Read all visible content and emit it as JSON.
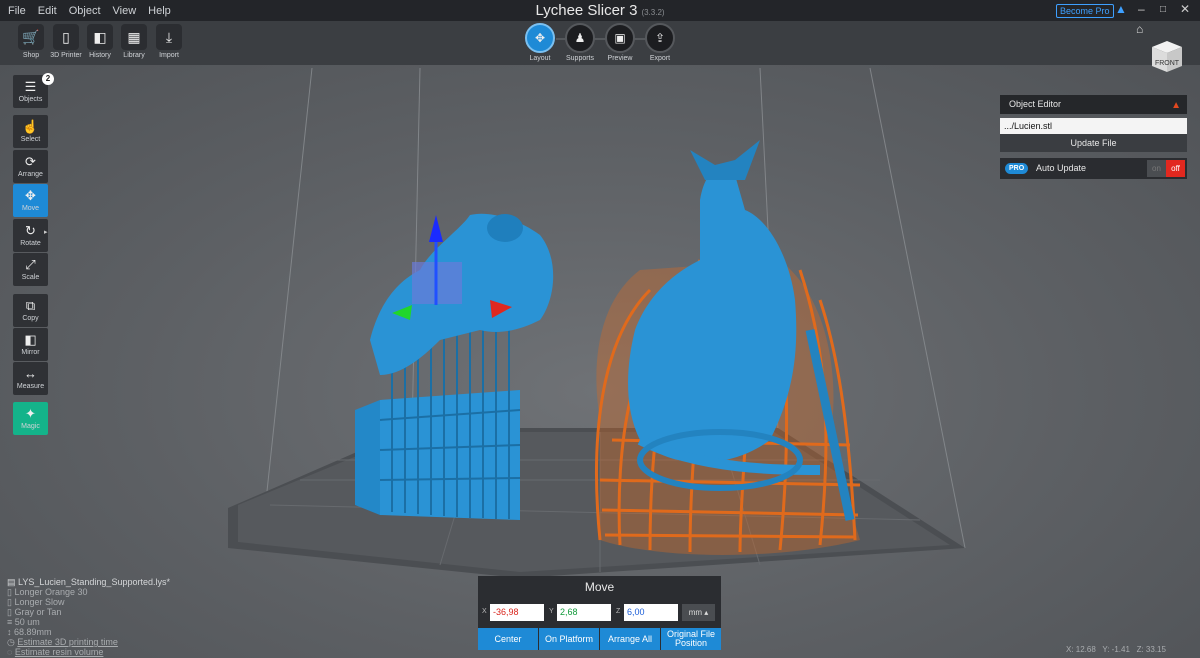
{
  "menu": [
    "File",
    "Edit",
    "Object",
    "View",
    "Help"
  ],
  "app": {
    "title": "Lychee Slicer 3",
    "version": "(3.3.2)",
    "become_pro": "Become Pro"
  },
  "toolbar": {
    "left": [
      {
        "label": "Shop",
        "icon": "cart-icon"
      },
      {
        "label": "3D Printer",
        "icon": "printer-icon"
      },
      {
        "label": "History",
        "icon": "history-icon"
      },
      {
        "label": "Library",
        "icon": "library-icon"
      },
      {
        "label": "Import",
        "icon": "import-icon"
      }
    ],
    "modes": [
      {
        "label": "Layout",
        "icon": "layout-icon",
        "active": true
      },
      {
        "label": "Supports",
        "icon": "supports-icon",
        "active": false
      },
      {
        "label": "Preview",
        "icon": "preview-icon",
        "active": false
      },
      {
        "label": "Export",
        "icon": "export-icon",
        "active": false
      }
    ]
  },
  "tools": [
    {
      "label": "Objects",
      "icon": "list-icon",
      "badge": "2"
    },
    {
      "label": "Select",
      "icon": "pointer-icon"
    },
    {
      "label": "Arrange",
      "icon": "arrange-icon"
    },
    {
      "label": "Move",
      "icon": "move-icon",
      "active": true
    },
    {
      "label": "Rotate",
      "icon": "rotate-icon"
    },
    {
      "label": "Scale",
      "icon": "scale-icon"
    },
    {
      "label": "Copy",
      "icon": "copy-icon"
    },
    {
      "label": "Mirror",
      "icon": "mirror-icon"
    },
    {
      "label": "Measure",
      "icon": "measure-icon"
    },
    {
      "label": "Magic",
      "icon": "magic-icon"
    }
  ],
  "viewcube": {
    "face": "FRONT"
  },
  "object_editor": {
    "title": "Object Editor",
    "file": ".../Lucien.stl",
    "update_button": "Update File",
    "pro_tag": "PRO",
    "auto_update": "Auto Update",
    "toggle_on": "on",
    "toggle_off": "off"
  },
  "move_panel": {
    "title": "Move",
    "x_label": "X",
    "x_value": "-36,98",
    "y_label": "Y",
    "y_value": "2,68",
    "z_label": "Z",
    "z_value": "6,00",
    "unit": "mm",
    "buttons": [
      "Center",
      "On Platform",
      "Arrange All",
      "Original File Position"
    ]
  },
  "file_info": {
    "name": "LYS_Lucien_Standing_Supported.lys*",
    "resin": "Longer Orange 30",
    "profile": "Longer Slow",
    "color": "Gray or Tan",
    "layer": "50 um",
    "height": "68.89mm",
    "time_link": "Estimate 3D printing time",
    "volume_link": "Estimate resin volume"
  },
  "coords": {
    "x": "X: 12.68",
    "y": "Y: -1.41",
    "z": "Z: 33.15"
  },
  "colors": {
    "accent": "#1e8ad6",
    "selected_model": "#2a93d5",
    "support_orange": "#e06a1c",
    "magic": "#14b38a"
  }
}
